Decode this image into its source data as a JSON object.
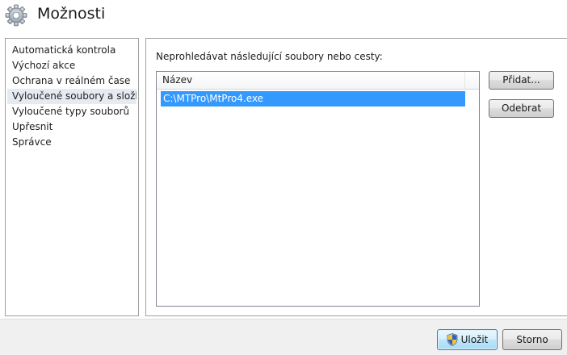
{
  "header": {
    "title": "Možnosti",
    "icon": "gear-icon"
  },
  "sidebar": {
    "items": [
      {
        "label": "Automatická kontrola",
        "selected": false
      },
      {
        "label": "Výchozí akce",
        "selected": false
      },
      {
        "label": "Ochrana v reálném čase",
        "selected": false
      },
      {
        "label": "Vyloučené soubory a složky",
        "selected": true
      },
      {
        "label": "Vyloučené typy souborů",
        "selected": false
      },
      {
        "label": "Upřesnit",
        "selected": false
      },
      {
        "label": "Správce",
        "selected": false
      }
    ]
  },
  "main": {
    "label": "Neprohledávat následující soubory nebo cesty:",
    "list": {
      "column_header": "Název",
      "rows": [
        {
          "value": "C:\\MTPro\\MtPro4.exe",
          "selected": true
        }
      ]
    },
    "add_label": "Přidat...",
    "remove_label": "Odebrat"
  },
  "footer": {
    "save_label": "Uložit",
    "save_icon": "uac-shield-icon",
    "cancel_label": "Storno"
  },
  "colors": {
    "selection": "#3399ff",
    "sidebar_selection": "#e6ebf2",
    "footer_bg": "#f0f0f0"
  }
}
